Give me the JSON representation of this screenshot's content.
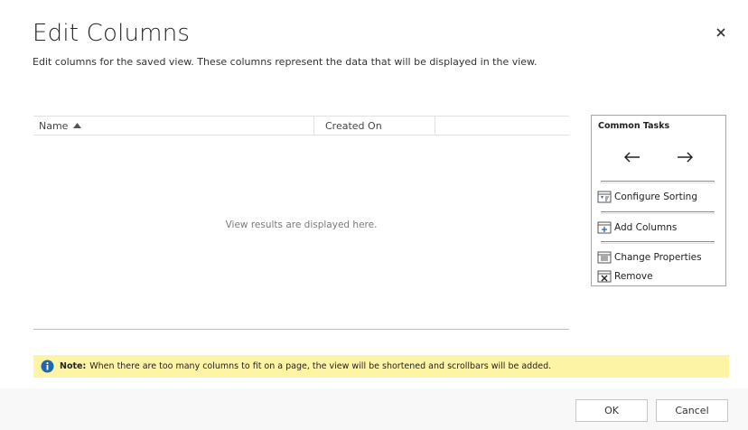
{
  "dialog": {
    "title": "Edit Columns",
    "subtitle": "Edit columns for the saved view. These columns represent the data that will be displayed in the view.",
    "close_icon": "close-icon"
  },
  "grid": {
    "columns": [
      {
        "label": "Name",
        "sort": "ascending"
      },
      {
        "label": "Created On"
      }
    ],
    "empty_message": "View results are displayed here."
  },
  "common_tasks": {
    "title": "Common Tasks",
    "move_left_icon": "arrow-left-icon",
    "move_right_icon": "arrow-right-icon",
    "items": [
      {
        "label": "Configure Sorting",
        "icon": "configure-sorting-icon"
      },
      {
        "label": "Add Columns",
        "icon": "add-columns-icon"
      },
      {
        "label": "Change Properties",
        "icon": "change-properties-icon"
      },
      {
        "label": "Remove",
        "icon": "remove-icon"
      }
    ]
  },
  "note": {
    "label": "Note:",
    "text": "When there are too many columns to fit on a page, the view will be shortened and scrollbars will be added.",
    "icon": "info-icon"
  },
  "footer": {
    "ok_label": "OK",
    "cancel_label": "Cancel"
  },
  "colors": {
    "note_background": "#fef4a6",
    "info_icon": "#2266b1",
    "footer_background": "#f8f8f8"
  }
}
